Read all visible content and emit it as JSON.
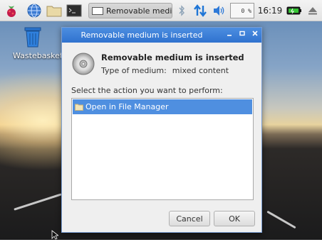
{
  "taskbar": {
    "task_title": "Removable medi...",
    "cpu_label": "0 %",
    "clock": "16:19",
    "icons": [
      "raspberry-menu-icon",
      "web-browser-icon",
      "file-manager-icon",
      "terminal-icon",
      "bluetooth-icon",
      "network-icon",
      "volume-icon",
      "battery-icon",
      "eject-icon"
    ]
  },
  "desktop": {
    "wastebasket_label": "Wastebasket"
  },
  "dialog": {
    "title": "Removable medium is inserted",
    "controls": [
      "minimize",
      "maximize",
      "close"
    ],
    "heading": "Removable medium is inserted",
    "media_type_label": "Type of medium:",
    "media_type_value": "mixed content",
    "prompt": "Select the action you want to perform:",
    "actions": [
      {
        "label": "Open in File Manager",
        "selected": true
      }
    ],
    "cancel_label": "Cancel",
    "ok_label": "OK"
  },
  "colors": {
    "title_bar": "#3a7fd9",
    "selection": "#4f8fe0"
  }
}
